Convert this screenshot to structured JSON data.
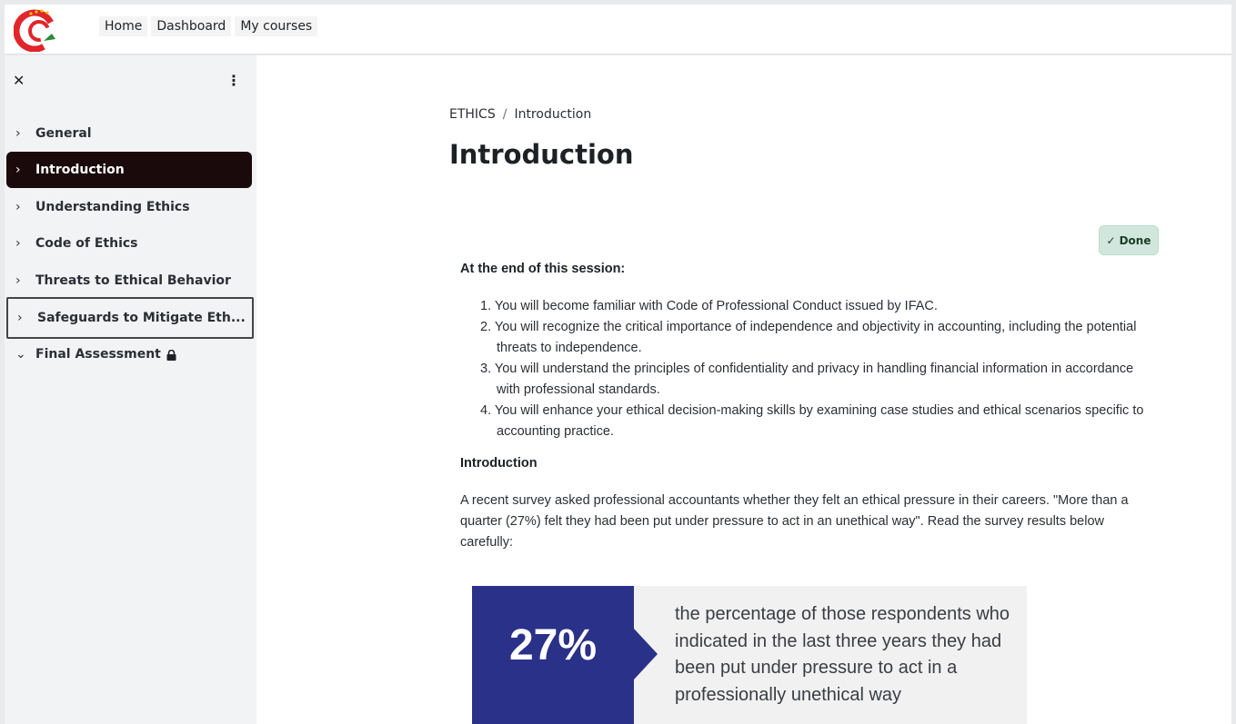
{
  "topnav": {
    "items": [
      "Home",
      "Dashboard",
      "My courses"
    ]
  },
  "sidebar": {
    "items": [
      {
        "label": "General"
      },
      {
        "label": "Introduction"
      },
      {
        "label": "Understanding Ethics"
      },
      {
        "label": "Code of Ethics"
      },
      {
        "label": "Threats to Ethical Behavior"
      },
      {
        "label": "Safeguards to Mitigate Eth..."
      },
      {
        "label": "Final Assessment"
      }
    ]
  },
  "breadcrumb": {
    "course": "ETHICS",
    "separator": "/",
    "current": "Introduction"
  },
  "page": {
    "title": "Introduction",
    "done_label": "Done"
  },
  "content": {
    "objectives_heading": "At the end of this session:",
    "objectives": [
      "1. You will become familiar with Code of Professional Conduct issued by IFAC.",
      "2. You will recognize the critical importance of independence and objectivity in accounting, including the potential threats to independence.",
      "3. You will understand the principles of confidentiality and privacy in handling financial information in accordance with professional standards.",
      "4. You will enhance your ethical decision-making skills by examining case studies and ethical scenarios specific to accounting practice."
    ],
    "intro_heading": "Introduction",
    "intro_paragraph": "A recent survey asked professional accountants whether they felt an ethical pressure in their careers. \"More than a quarter (27%) felt they had been put under pressure to act in an unethical way\". Read the survey results below carefully:"
  },
  "stat": {
    "number": "27%",
    "text": "the percentage of those respondents who indicated in the last three years they had been put under pressure to act in a professionally unethical way"
  },
  "colors": {
    "active_item": "#1a0a0c",
    "stat_blue": "#2a3188",
    "done_bg": "#d1e7dd"
  }
}
